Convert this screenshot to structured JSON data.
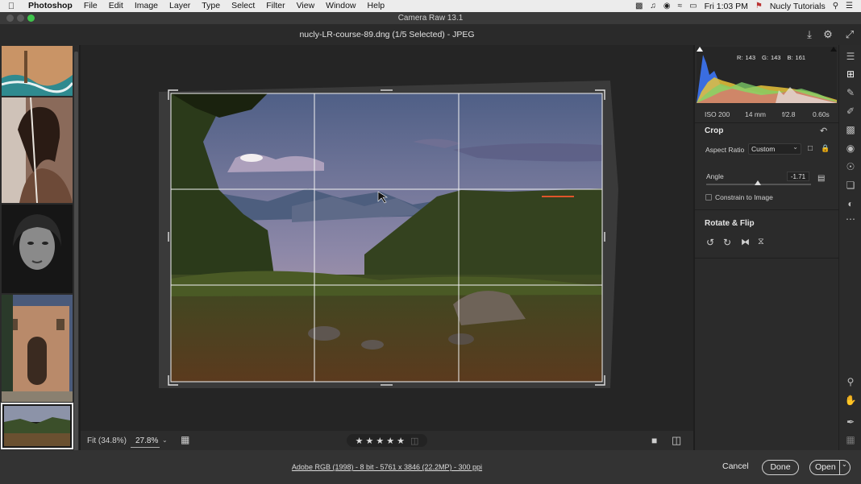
{
  "menubar": {
    "items": [
      "Photoshop",
      "File",
      "Edit",
      "Image",
      "Layer",
      "Type",
      "Select",
      "Filter",
      "View",
      "Window",
      "Help"
    ],
    "clock": "Fri 1:03 PM",
    "user": "Nucly Tutorials"
  },
  "window": {
    "title": "Camera Raw 13.1"
  },
  "header": {
    "filename": "nucly-LR-course-89.dng (1/5 Selected)  -  JPEG"
  },
  "histogram": {
    "r_label": "R:",
    "r_value": "143",
    "g_label": "G:",
    "g_value": "143",
    "b_label": "B:",
    "b_value": "161"
  },
  "exif": {
    "iso": "ISO 200",
    "focal": "14 mm",
    "aperture": "f/2.8",
    "shutter": "0.60s"
  },
  "crop_panel": {
    "title": "Crop",
    "aspect_label": "Aspect Ratio",
    "aspect_value": "Custom",
    "angle_label": "Angle",
    "angle_value": "-1.71",
    "angle_fraction": 0.49,
    "constrain_label": "Constrain to Image"
  },
  "rotate_panel": {
    "title": "Rotate & Flip"
  },
  "bottombar": {
    "fit": "Fit (34.8%)",
    "zoom": "27.8%",
    "rating": [
      "★",
      "★",
      "★",
      "★",
      "★"
    ]
  },
  "footer": {
    "workflow": "Adobe RGB (1998) - 8 bit - 5761 x 3846 (22.2MP) - 300 ppi",
    "cancel": "Cancel",
    "done": "Done",
    "open": "Open"
  }
}
